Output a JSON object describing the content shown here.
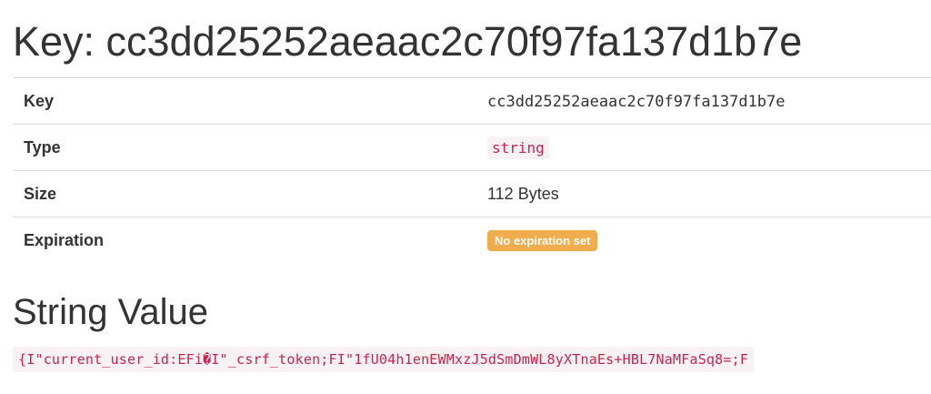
{
  "page": {
    "title": "Key: cc3dd25252aeaac2c70f97fa137d1b7e"
  },
  "properties": {
    "key": {
      "label": "Key",
      "value": "cc3dd25252aeaac2c70f97fa137d1b7e"
    },
    "type": {
      "label": "Type",
      "value": "string"
    },
    "size": {
      "label": "Size",
      "value": "112 Bytes"
    },
    "expiration": {
      "label": "Expiration",
      "value": "No expiration set"
    }
  },
  "string_value": {
    "heading": "String Value",
    "content": "{I\"current_user_id:EFi�I\"_csrf_token;FI\"1fU04h1enEWMxzJ5dSmDmWL8yXTnaEs+HBL7NaMFaSq8=;F"
  },
  "colors": {
    "text": "#333333",
    "code_text": "#c7254e",
    "code_bg": "#f9f2f4",
    "warning_badge": "#f0ad4e",
    "border": "#dddddd"
  }
}
